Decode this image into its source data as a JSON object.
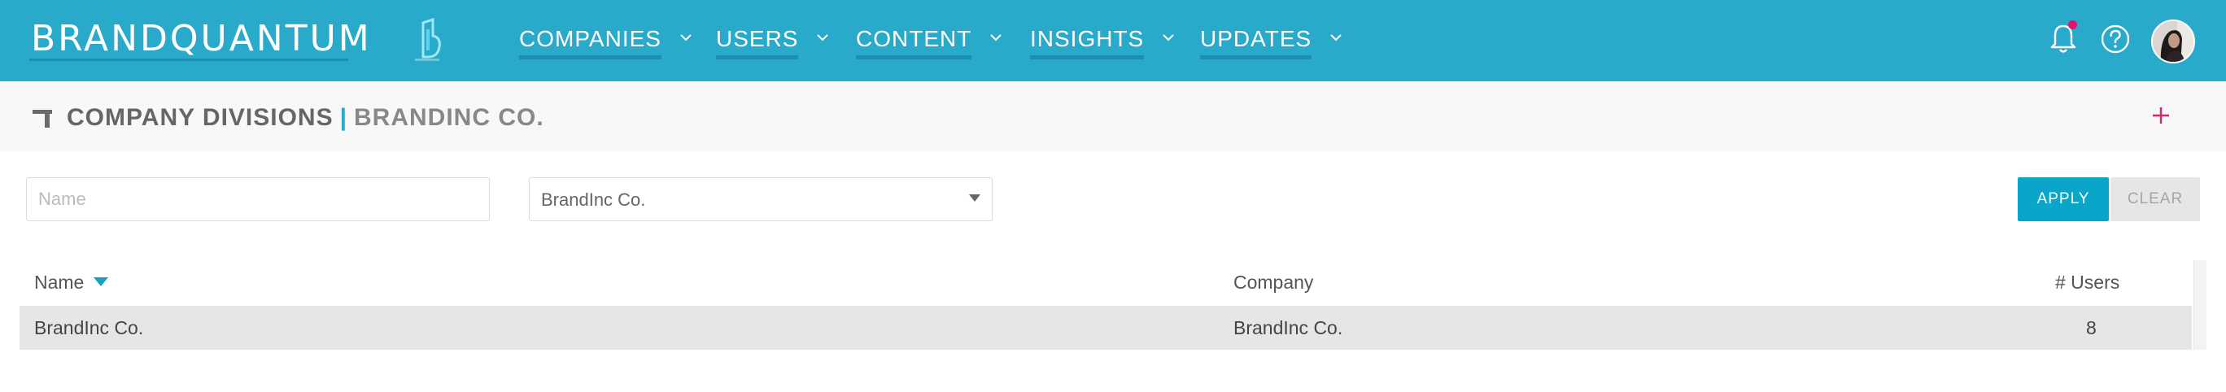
{
  "app": {
    "brand": "BRANDQUANTUM",
    "colors": {
      "nav_bg": "#2aaacb",
      "accent": "#0aa5c9",
      "add": "#d6246e",
      "notification": "#e0156b"
    }
  },
  "nav": {
    "items": [
      {
        "label": "COMPANIES",
        "icon": "chevron-down-icon"
      },
      {
        "label": "USERS",
        "icon": "chevron-down-icon"
      },
      {
        "label": "CONTENT",
        "icon": "chevron-down-icon"
      },
      {
        "label": "INSIGHTS",
        "icon": "chevron-down-icon"
      },
      {
        "label": "UPDATES",
        "icon": "chevron-down-icon"
      }
    ],
    "right_icons": [
      "bell-icon",
      "help-icon",
      "avatar"
    ]
  },
  "page": {
    "title": "COMPANY DIVISIONS",
    "separator": "|",
    "subtitle": "BRANDINC CO."
  },
  "filters": {
    "name_placeholder": "Name",
    "name_value": "",
    "company_selected": "BrandInc Co.",
    "apply_label": "APPLY",
    "clear_label": "CLEAR"
  },
  "table": {
    "columns": [
      "Name",
      "Company",
      "# Users"
    ],
    "sorted_by": "Name",
    "rows": [
      {
        "name": "BrandInc Co.",
        "company": "BrandInc Co.",
        "users": "8"
      }
    ]
  }
}
